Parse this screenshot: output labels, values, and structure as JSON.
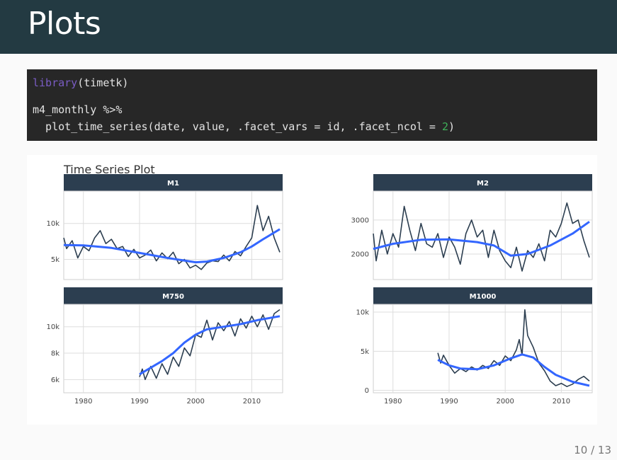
{
  "slide": {
    "title": "Plots",
    "page": "10 / 13"
  },
  "code": {
    "line1_fn": "library",
    "line1_rest": "(timetk)",
    "line2": "m4_monthly %>%",
    "line3_start": "  plot_time_series(date, value, .facet_vars = id, .facet_ncol = ",
    "line3_num": "2",
    "line3_end": ")"
  },
  "colors": {
    "header_bg": "#233a42",
    "code_bg": "#272727",
    "series_line": "#2c3e50",
    "smooth_line": "#3366ff",
    "strip_bg": "#2c3e50"
  },
  "chart_data": [
    {
      "type": "line",
      "title": "Time Series Plot",
      "facet": "M1",
      "xlim": [
        1976.5,
        2015.5
      ],
      "ylim": [
        2200,
        14500
      ],
      "yticks": [
        5000,
        10000
      ],
      "ytick_labels": [
        "5k",
        "10k"
      ],
      "xticks": [
        1980,
        1990,
        2000,
        2010
      ],
      "xtick_labels": [
        "1980",
        "1990",
        "2000",
        "2010"
      ],
      "show_x_labels": false,
      "series": [
        {
          "name": "value",
          "x": [
            1976.5,
            1977,
            1978,
            1979,
            1980,
            1981,
            1982,
            1983,
            1984,
            1985,
            1986,
            1987,
            1988,
            1989,
            1990,
            1991,
            1992,
            1993,
            1994,
            1995,
            1996,
            1997,
            1998,
            1999,
            2000,
            2001,
            2002,
            2003,
            2004,
            2005,
            2006,
            2007,
            2008,
            2009,
            2010,
            2011,
            2012,
            2013,
            2014,
            2015
          ],
          "y": [
            8000,
            6500,
            7600,
            5200,
            6800,
            6200,
            8000,
            9000,
            7200,
            7800,
            6500,
            6800,
            5400,
            6400,
            5200,
            5600,
            6300,
            4800,
            5900,
            5100,
            6000,
            4400,
            5000,
            3800,
            4200,
            3600,
            4500,
            4800,
            4700,
            5600,
            4800,
            6100,
            5500,
            6800,
            8000,
            12500,
            9000,
            11000,
            8000,
            6000
          ]
        },
        {
          "name": "smooth",
          "x": [
            1976.5,
            1980,
            1985,
            1990,
            1995,
            2000,
            2002,
            2005,
            2008,
            2010,
            2012,
            2015
          ],
          "y": [
            7000,
            6950,
            6600,
            5900,
            5200,
            4600,
            4700,
            5200,
            6000,
            6800,
            7800,
            9200
          ]
        }
      ]
    },
    {
      "type": "line",
      "facet": "M2",
      "xlim": [
        1976.5,
        2015.5
      ],
      "ylim": [
        1250,
        3850
      ],
      "yticks": [
        2000,
        3000
      ],
      "ytick_labels": [
        "2000",
        "3000"
      ],
      "xticks": [
        1980,
        1990,
        2000,
        2010
      ],
      "xtick_labels": [
        "1980",
        "1990",
        "2000",
        "2010"
      ],
      "show_x_labels": false,
      "series": [
        {
          "name": "value",
          "x": [
            1976.5,
            1977,
            1978,
            1979,
            1980,
            1981,
            1982,
            1983,
            1984,
            1985,
            1986,
            1987,
            1988,
            1989,
            1990,
            1991,
            1992,
            1993,
            1994,
            1995,
            1996,
            1997,
            1998,
            1999,
            2000,
            2001,
            2002,
            2003,
            2004,
            2005,
            2006,
            2007,
            2008,
            2009,
            2010,
            2011,
            2012,
            2013,
            2014,
            2015
          ],
          "y": [
            2600,
            1800,
            2700,
            2000,
            2600,
            2200,
            3400,
            2700,
            2100,
            2900,
            2300,
            2200,
            2600,
            1900,
            2500,
            2200,
            1700,
            2600,
            3000,
            2500,
            2700,
            1900,
            2700,
            2100,
            1800,
            1600,
            2200,
            1500,
            2100,
            1900,
            2300,
            1800,
            2700,
            2500,
            2900,
            3500,
            2900,
            3000,
            2400,
            1900
          ]
        },
        {
          "name": "smooth",
          "x": [
            1976.5,
            1980,
            1985,
            1990,
            1995,
            1998,
            2001,
            2004,
            2008,
            2012,
            2015
          ],
          "y": [
            2150,
            2300,
            2420,
            2430,
            2350,
            2250,
            1950,
            2000,
            2250,
            2600,
            2950
          ]
        }
      ]
    },
    {
      "type": "line",
      "facet": "M750",
      "xlim": [
        1976.5,
        2015.5
      ],
      "ylim": [
        5000,
        11700
      ],
      "yticks": [
        6000,
        8000,
        10000
      ],
      "ytick_labels": [
        "6k",
        "8k",
        "10k"
      ],
      "xticks": [
        1980,
        1990,
        2000,
        2010
      ],
      "xtick_labels": [
        "1980",
        "1990",
        "2000",
        "2010"
      ],
      "show_x_labels": true,
      "series": [
        {
          "name": "value",
          "x": [
            1990,
            1990.5,
            1991,
            1992,
            1993,
            1994,
            1995,
            1996,
            1997,
            1998,
            1999,
            2000,
            2001,
            2002,
            2003,
            2004,
            2005,
            2006,
            2007,
            2008,
            2009,
            2010,
            2011,
            2012,
            2013,
            2014,
            2015
          ],
          "y": [
            6200,
            6800,
            6000,
            7000,
            6100,
            7200,
            6400,
            7700,
            7000,
            8400,
            7800,
            9400,
            9200,
            10500,
            9000,
            10300,
            9700,
            10400,
            9300,
            10600,
            9900,
            10800,
            10000,
            10900,
            9800,
            11000,
            11300
          ]
        },
        {
          "name": "smooth",
          "x": [
            1990,
            1992,
            1994,
            1996,
            1998,
            2000,
            2002,
            2005,
            2008,
            2011,
            2015
          ],
          "y": [
            6400,
            6900,
            7400,
            8000,
            8800,
            9400,
            9800,
            10000,
            10200,
            10500,
            10800
          ]
        }
      ]
    },
    {
      "type": "line",
      "facet": "M1000",
      "xlim": [
        1976.5,
        2015.5
      ],
      "ylim": [
        -300,
        11000
      ],
      "yticks": [
        0,
        5000,
        10000
      ],
      "ytick_labels": [
        "0",
        "5k",
        "10k"
      ],
      "xticks": [
        1980,
        1990,
        2000,
        2010
      ],
      "xtick_labels": [
        "1980",
        "1990",
        "2000",
        "2010"
      ],
      "show_x_labels": true,
      "series": [
        {
          "name": "value",
          "x": [
            1988,
            1988.5,
            1989,
            1990,
            1991,
            1992,
            1993,
            1994,
            1995,
            1996,
            1997,
            1998,
            1999,
            2000,
            2001,
            2002,
            2002.5,
            2003,
            2003.5,
            2004,
            2005,
            2006,
            2007,
            2008,
            2009,
            2010,
            2011,
            2012,
            2013,
            2014,
            2015
          ],
          "y": [
            4800,
            3500,
            4500,
            3200,
            2200,
            2800,
            2400,
            3000,
            2600,
            3200,
            2800,
            3800,
            3200,
            4400,
            3800,
            5200,
            6500,
            4500,
            10300,
            7000,
            5500,
            3500,
            2500,
            1200,
            600,
            900,
            500,
            800,
            1400,
            1800,
            1200
          ]
        },
        {
          "name": "smooth",
          "x": [
            1988,
            1990,
            1992,
            1995,
            1998,
            2001,
            2003,
            2005,
            2007,
            2009,
            2012,
            2015
          ],
          "y": [
            3900,
            3200,
            2800,
            2700,
            3200,
            4100,
            4600,
            4200,
            3000,
            2000,
            1100,
            600
          ]
        }
      ]
    }
  ]
}
